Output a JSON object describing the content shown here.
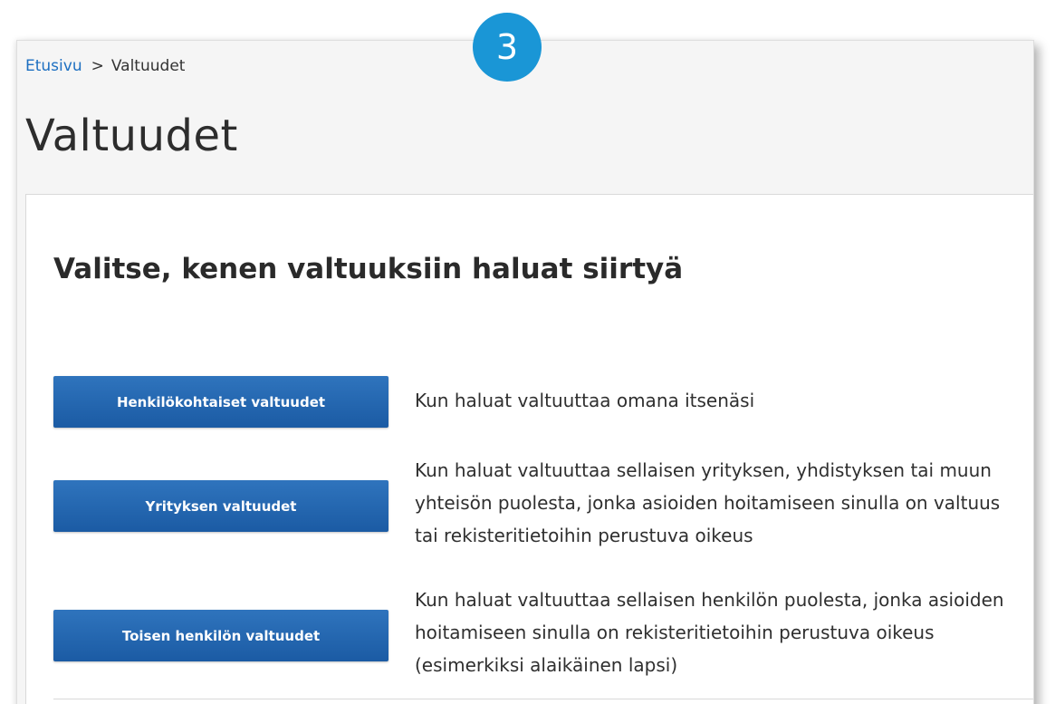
{
  "breadcrumb": {
    "home": "Etusivu",
    "separator": ">",
    "current": "Valtuudet"
  },
  "page": {
    "title": "Valtuudet"
  },
  "card": {
    "heading": "Valitse, kenen valtuuksiin haluat siirtyä"
  },
  "options": [
    {
      "button_label": "Henkilökohtaiset valtuudet",
      "description": "Kun haluat valtuuttaa omana itsenäsi"
    },
    {
      "button_label": "Yrityksen valtuudet",
      "description": "Kun haluat valtuuttaa sellaisen yrityksen, yhdistyksen tai muun yhteisön puolesta, jonka asioiden hoitamiseen sinulla on valtuus tai rekisteritietoihin perustuva oikeus"
    },
    {
      "button_label": "Toisen henkilön valtuudet",
      "description": "Kun haluat valtuuttaa sellaisen henkilön puolesta, jonka asioiden hoitamiseen sinulla on rekisteritietoihin perustuva oikeus (esimerkiksi alaikäinen lapsi)"
    }
  ],
  "step_badge": {
    "number": "3"
  },
  "colors": {
    "link": "#1d6fc1",
    "button": "#2166b0",
    "badge": "#1a96d6"
  }
}
